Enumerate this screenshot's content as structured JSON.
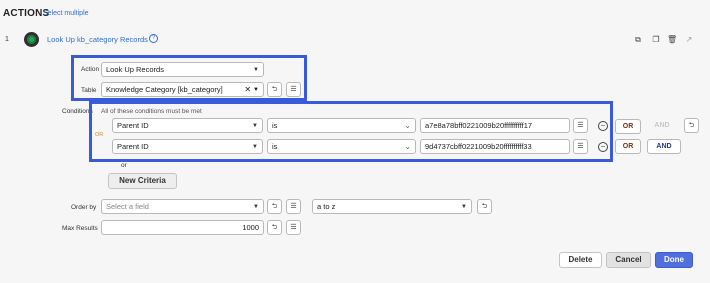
{
  "header": {
    "title": "ACTIONS",
    "select_multiple": "Select multiple"
  },
  "step": {
    "number": "1",
    "title": "Look Up kb_category Records",
    "help_icon": "?",
    "tools": [
      "copy-icon",
      "duplicate-icon",
      "trash-icon",
      "open-icon"
    ]
  },
  "action": {
    "label": "Action",
    "value": "Look Up Records"
  },
  "table": {
    "label": "Table",
    "value": "Knowledge Category [kb_category]"
  },
  "conditions": {
    "label": "Conditions",
    "note": "All of these conditions must be met",
    "or_marker": "OR",
    "rows": [
      {
        "field": "Parent ID",
        "operator": "is",
        "value": "a7e8a78bff0221009b20ffffffffff17",
        "or_label": "OR",
        "and_label": "AND",
        "and_enabled": false
      },
      {
        "field": "Parent ID",
        "operator": "is",
        "value": "9d4737cbff0221009b20ffffffffff33",
        "or_label": "OR",
        "and_label": "AND",
        "and_enabled": true
      }
    ],
    "or_between": "or",
    "new_criteria": "New Criteria"
  },
  "order_by": {
    "label": "Order by",
    "placeholder": "Select a field",
    "direction": "a to z"
  },
  "max_results": {
    "label": "Max Results",
    "value": "1000"
  },
  "footer": {
    "delete": "Delete",
    "cancel": "Cancel",
    "done": "Done"
  },
  "colors": {
    "accent": "#3a5bd9",
    "link": "#2d6fd1",
    "done": "#4f6fde"
  }
}
